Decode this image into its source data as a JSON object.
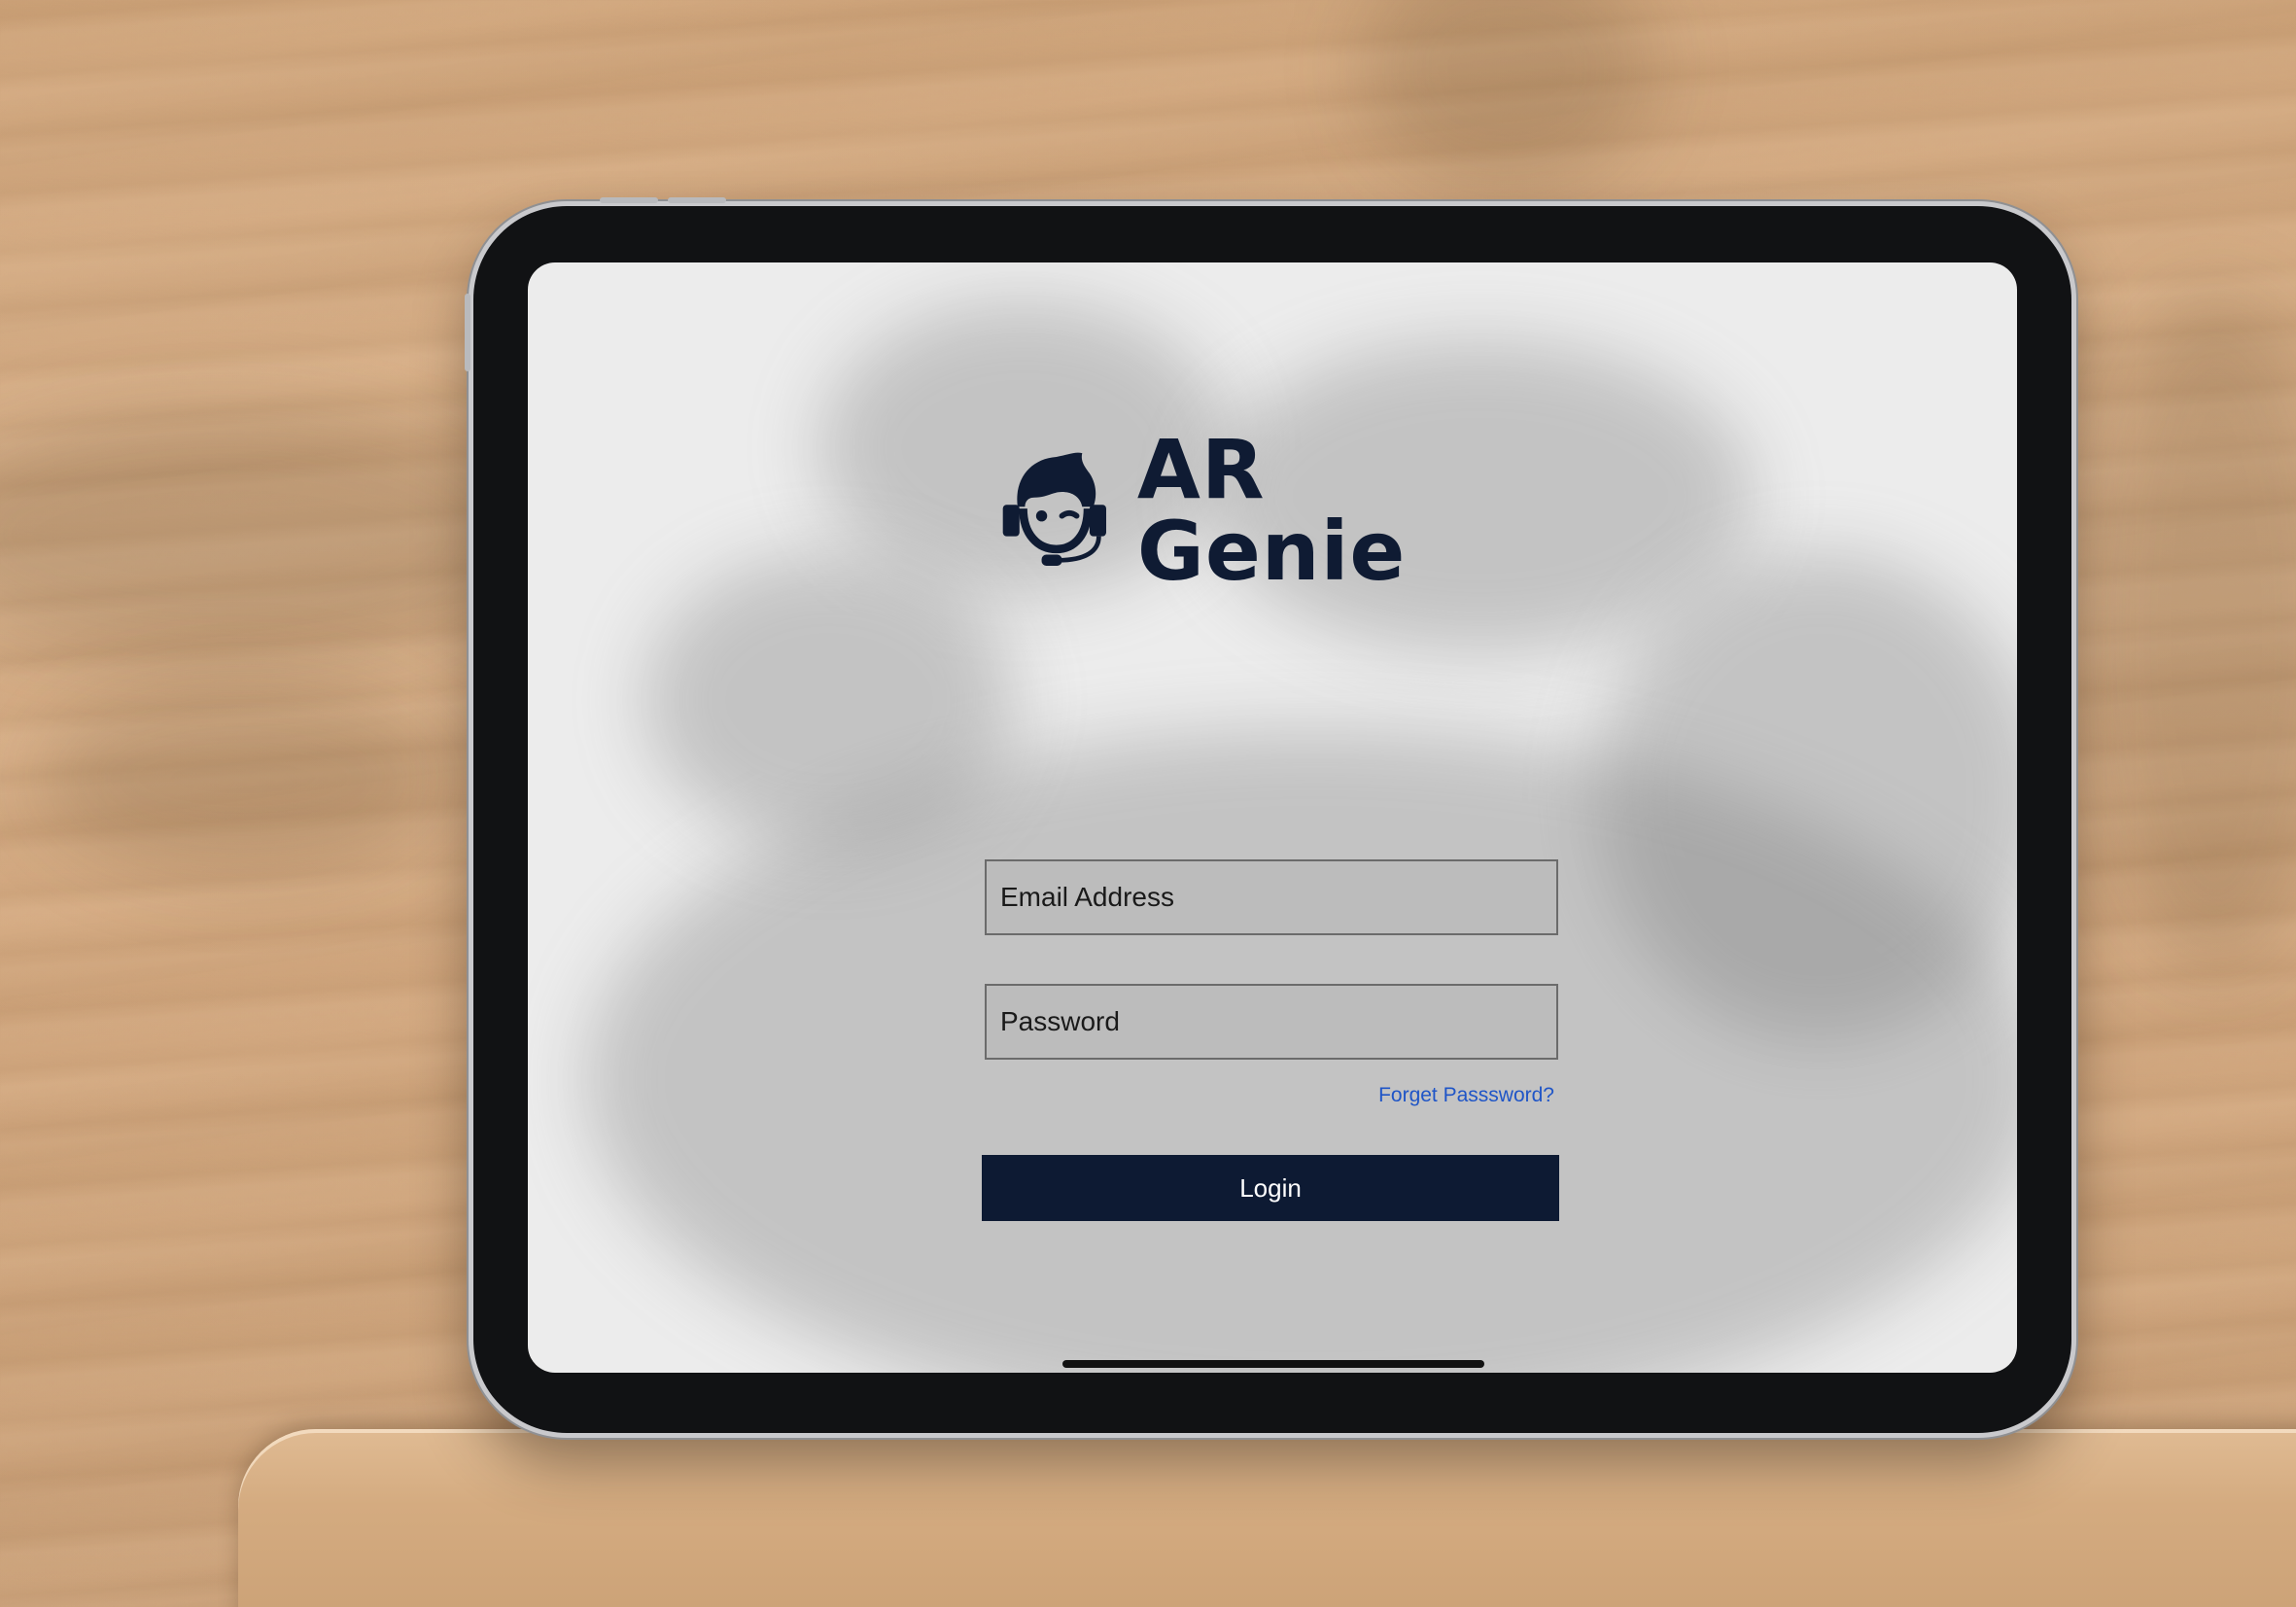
{
  "app": {
    "name": "AR Genie",
    "logo_icon": "support-agent-headset-icon"
  },
  "login_form": {
    "email_placeholder": "Email Address",
    "password_placeholder": "Password",
    "forgot_password_label": "Forget Passsword?",
    "login_label": "Login"
  },
  "colors": {
    "brand": "#0f1b33",
    "login_button": "#0d1a33",
    "link": "#1f55c7"
  }
}
